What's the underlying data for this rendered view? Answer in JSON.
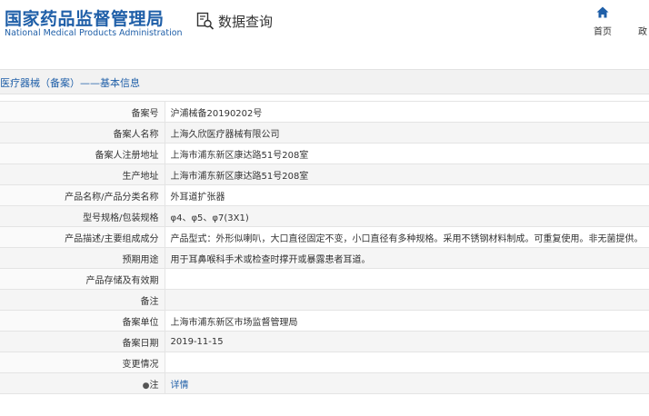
{
  "header": {
    "brand_cn": "国家药品监督管理局",
    "brand_en": "National Medical Products Administration",
    "query_label": "数据查询",
    "nav": {
      "home_label": "首页",
      "gov_label": "政"
    },
    "colors": {
      "brand": "#1f5fa8",
      "link": "#1f5fa8"
    },
    "icons": {
      "query": "document-search-icon",
      "home": "home-icon",
      "note": "pin-icon"
    }
  },
  "section": {
    "title": "医疗器械（备案）——基本信息"
  },
  "rows": [
    {
      "label": "备案号",
      "value": "沪浦械备20190202号"
    },
    {
      "label": "备案人名称",
      "value": "上海久欣医疗器械有限公司"
    },
    {
      "label": "备案人注册地址",
      "value": "上海市浦东新区康达路51号208室"
    },
    {
      "label": "生产地址",
      "value": "上海市浦东新区康达路51号208室"
    },
    {
      "label": "产品名称/产品分类名称",
      "value": "外耳道扩张器"
    },
    {
      "label": "型号规格/包装规格",
      "value": "φ4、φ5、φ7(3X1)"
    },
    {
      "label": "产品描述/主要组成成分",
      "value": "产品型式：外形似喇叭，大口直径固定不变，小口直径有多种规格。采用不锈钢材料制成。可重复使用。非无菌提供。"
    },
    {
      "label": "预期用途",
      "value": "用于耳鼻喉科手术或检查时撑开或暴露患者耳道。"
    },
    {
      "label": "产品存储及有效期",
      "value": ""
    },
    {
      "label": "备注",
      "value": ""
    },
    {
      "label": "备案单位",
      "value": "上海市浦东新区市场监督管理局"
    },
    {
      "label": "备案日期",
      "value": "2019-11-15"
    },
    {
      "label": "变更情况",
      "value": ""
    }
  ],
  "note_row": {
    "pin_glyph": "●",
    "label": "注",
    "link": "详情"
  }
}
